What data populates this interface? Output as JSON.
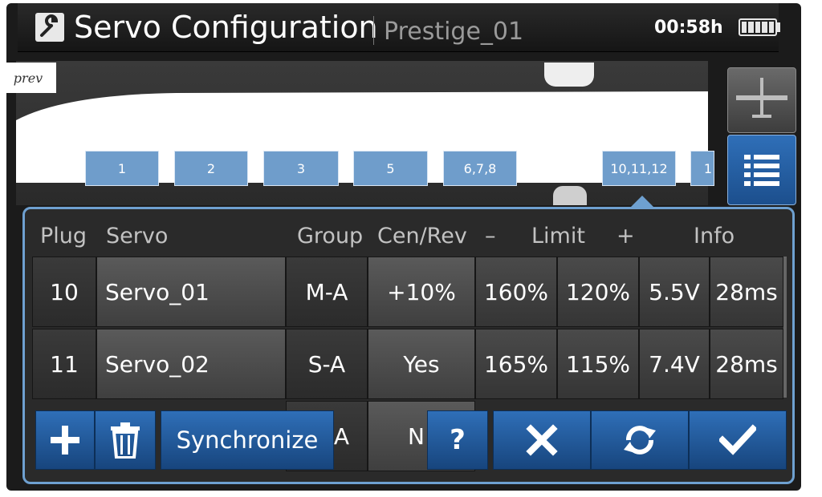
{
  "header": {
    "title": "Servo Configuration",
    "model": "Prestige_01",
    "time": "00:58h"
  },
  "nav": {
    "prev_label": "prev"
  },
  "diagram": {
    "plugs": [
      "1",
      "2",
      "3",
      "5",
      "6,7,8",
      "10,11,12",
      "1"
    ]
  },
  "table": {
    "headers": [
      "Plug",
      "Servo",
      "Group",
      "Cen/Rev",
      "–",
      "Limit",
      "+",
      "Info"
    ],
    "rows": [
      {
        "plug": "10",
        "servo": "Servo_01",
        "group": "M-A",
        "cenrev": "+10%",
        "limit_minus": "160%",
        "limit_plus": "120%",
        "voltage": "5.5V",
        "period": "28ms"
      },
      {
        "plug": "11",
        "servo": "Servo_02",
        "group": "S-A",
        "cenrev": "Yes",
        "limit_minus": "165%",
        "limit_plus": "115%",
        "voltage": "7.4V",
        "period": "28ms"
      },
      {
        "group": "A",
        "cenrev": "N"
      }
    ]
  },
  "toolbar": {
    "synchronize_label": "Synchronize",
    "help_label": "?"
  },
  "colors": {
    "accent": "#2f6fb8",
    "plug_box": "#6f9dcb",
    "panel_border": "#6ea0d0"
  },
  "icons": [
    "wrench-icon",
    "battery-icon",
    "airplane-icon",
    "list-icon",
    "plus-icon",
    "trash-icon",
    "close-icon",
    "sync-icon",
    "check-icon"
  ]
}
